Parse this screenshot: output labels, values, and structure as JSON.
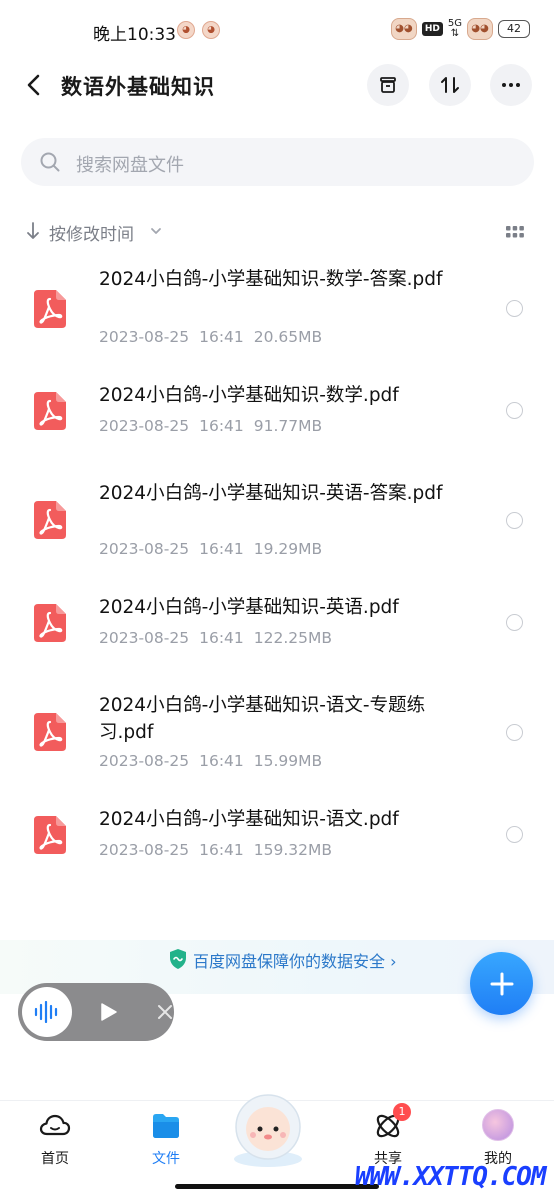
{
  "status_bar": {
    "time": "晚上10:33",
    "hd": "HD",
    "network": "5G",
    "battery": "42"
  },
  "header": {
    "title": "数语外基础知识"
  },
  "search": {
    "placeholder": "搜索网盘文件"
  },
  "sort": {
    "label": "按修改时间"
  },
  "files": [
    {
      "name": "2024小白鸽-小学基础知识-数学-答案.pdf",
      "date": "2023-08-25",
      "time": "16:41",
      "size": "20.65MB"
    },
    {
      "name": "2024小白鸽-小学基础知识-数学.pdf",
      "date": "2023-08-25",
      "time": "16:41",
      "size": "91.77MB"
    },
    {
      "name": "2024小白鸽-小学基础知识-英语-答案.pdf",
      "date": "2023-08-25",
      "time": "16:41",
      "size": "19.29MB"
    },
    {
      "name": "2024小白鸽-小学基础知识-英语.pdf",
      "date": "2023-08-25",
      "time": "16:41",
      "size": "122.25MB"
    },
    {
      "name": "2024小白鸽-小学基础知识-语文-专题练习.pdf",
      "date": "2023-08-25",
      "time": "16:41",
      "size": "15.99MB"
    },
    {
      "name": "2024小白鸽-小学基础知识-语文.pdf",
      "date": "2023-08-25",
      "time": "16:41",
      "size": "159.32MB"
    }
  ],
  "security_banner": {
    "text": "百度网盘保障你的数据安全 ›"
  },
  "bottom_nav": {
    "items": [
      {
        "label": "首页"
      },
      {
        "label": "文件"
      },
      {
        "label": "共享",
        "badge": "1"
      },
      {
        "label": "我的"
      }
    ]
  },
  "watermark": "WWW.XXTTQ.COM",
  "colors": {
    "accent": "#1f7ef5",
    "pdf_red": "#f25c5c",
    "badge": "#ff4d4f"
  }
}
